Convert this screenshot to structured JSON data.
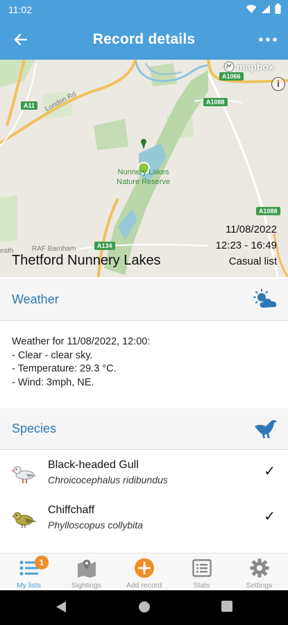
{
  "status_bar": {
    "time": "11:02"
  },
  "header": {
    "title": "Record details"
  },
  "map": {
    "roads": {
      "london_rd": "London Rd",
      "a11": "A11",
      "a1088_top": "A1088",
      "a1088_mid": "A1088",
      "a1088_right": "A1088",
      "a134": "A134",
      "a1066": "A1066"
    },
    "reserve_label_line1": "Nunnery Lakes",
    "reserve_label_line2": "Nature Reserve",
    "place_label": "RAF Barnham",
    "place_label_left": "eath",
    "attribution": "mapbox",
    "info_symbol": "i"
  },
  "record": {
    "site": "Thetford Nunnery Lakes",
    "date": "11/08/2022",
    "time": "12:23 - 16:49",
    "list_type": "Casual list"
  },
  "weather": {
    "section_title": "Weather",
    "icon": "partly-cloudy-icon",
    "lines": [
      "Weather for 11/08/2022, 12:00:",
      "- Clear - clear sky.",
      "- Temperature: 29.3 °C.",
      "- Wind: 3mph, NE."
    ]
  },
  "species": {
    "section_title": "Species",
    "icon": "bird-icon",
    "items": [
      {
        "name": "Black-headed Gull",
        "latin": "Chroicocephalus ridibundus",
        "check": "✓"
      },
      {
        "name": "Chiffchaff",
        "latin": "Phylloscopus collybita",
        "check": "✓"
      }
    ]
  },
  "bottom_nav": {
    "items": [
      {
        "label": "My lists",
        "badge": "1"
      },
      {
        "label": "Sightings"
      },
      {
        "label": "Add record"
      },
      {
        "label": "Stats"
      },
      {
        "label": "Settings"
      }
    ]
  },
  "colors": {
    "primary": "#4b9fdb",
    "accent": "#f28c28",
    "section_title": "#2f78b6"
  }
}
